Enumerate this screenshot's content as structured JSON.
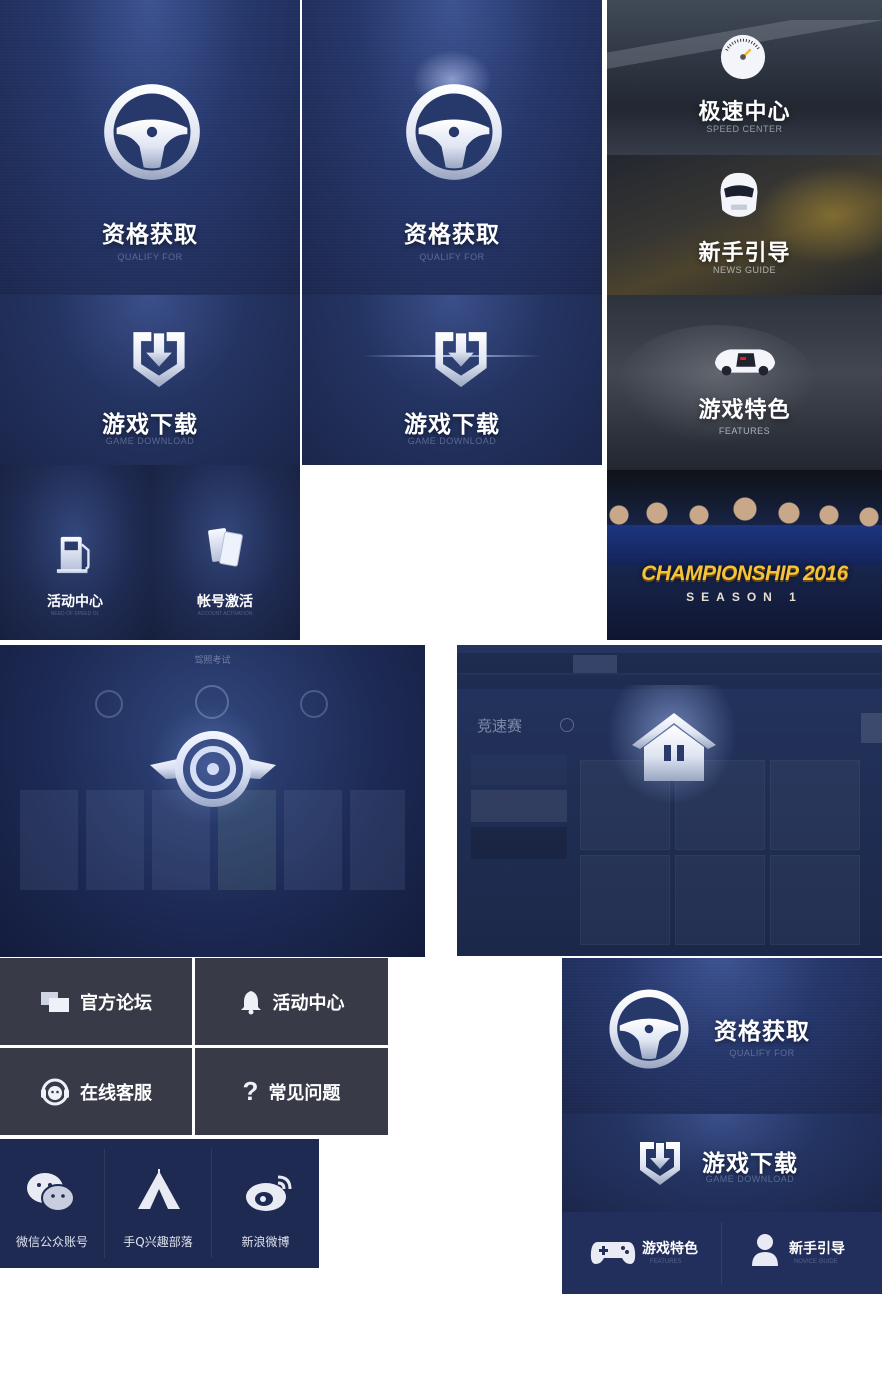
{
  "colors": {
    "panel_blue": "#243462",
    "panel_dark": "#1b264b",
    "gray_button": "#383b47",
    "social_bg": "#1e2a52",
    "gold": "#f5c33b"
  },
  "col1": {
    "qualify": {
      "title": "资格获取",
      "subtitle": "QUALIFY FOR",
      "icon": "steering-wheel-icon"
    },
    "download": {
      "title": "游戏下载",
      "subtitle": "GAME DOWNLOAD",
      "icon": "download-shield-icon"
    },
    "activity": {
      "title": "活动中心",
      "subtitle": "NEED OF SPEED OL",
      "icon": "fuel-pump-icon"
    },
    "activate": {
      "title": "帐号激活",
      "subtitle": "ACCOUNT ACTIVATION",
      "icon": "cards-icon"
    }
  },
  "col2": {
    "qualify": {
      "title": "资格获取",
      "subtitle": "QUALIFY FOR",
      "icon": "steering-wheel-icon"
    },
    "download": {
      "title": "游戏下载",
      "subtitle": "GAME DOWNLOAD",
      "icon": "download-shield-icon"
    }
  },
  "col3": {
    "speed": {
      "title": "极速中心",
      "subtitle": "SPEED CENTER",
      "icon": "speedometer-icon"
    },
    "guide": {
      "title": "新手引导",
      "subtitle": "NEWS GUIDE",
      "icon": "helmet-icon"
    },
    "features": {
      "title": "游戏特色",
      "subtitle": "FEATURES",
      "icon": "race-car-icon"
    },
    "championship": {
      "title": "CHAMPIONSHIP 2016",
      "subtitle": "SEASON 1"
    }
  },
  "exam_screen": {
    "title": "驾照考试"
  },
  "race_screen": {
    "heading": "竞速赛",
    "icon": "home-icon"
  },
  "gray_buttons": [
    {
      "label": "官方论坛",
      "icon": "forum-icon"
    },
    {
      "label": "活动中心",
      "icon": "bell-icon"
    },
    {
      "label": "在线客服",
      "icon": "headset-icon"
    },
    {
      "label": "常见问题",
      "icon": "question-icon"
    }
  ],
  "social": [
    {
      "label": "微信公众账号",
      "icon": "wechat-icon"
    },
    {
      "label": "手Q兴趣部落",
      "icon": "tent-icon"
    },
    {
      "label": "新浪微博",
      "icon": "weibo-icon"
    }
  ],
  "bottom_right": {
    "qualify": {
      "title": "资格获取",
      "subtitle": "QUALIFY FOR"
    },
    "download": {
      "title": "游戏下载",
      "subtitle": "GAME DOWNLOAD"
    },
    "features": {
      "title": "游戏特色",
      "subtitle": "FEATURES"
    },
    "guide": {
      "title": "新手引导",
      "subtitle": "NOVICE GUIDE"
    }
  }
}
